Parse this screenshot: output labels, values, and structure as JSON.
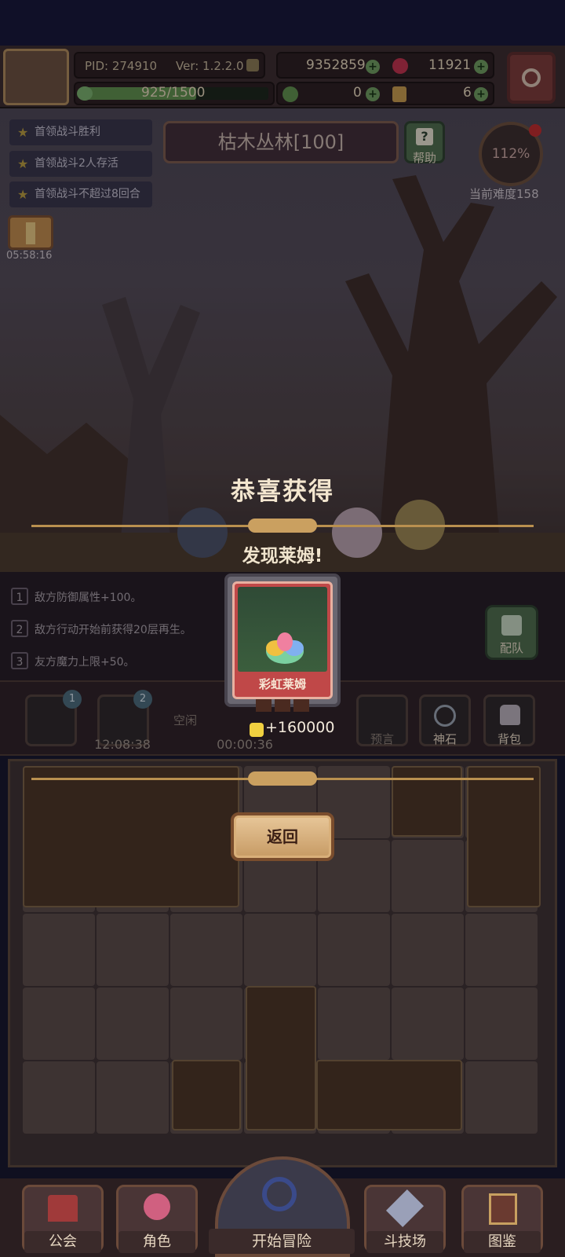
{
  "header": {
    "pid": "PID: 274910",
    "version": "Ver: 1.2.2.0",
    "exp_text": "925/1500",
    "exp_progress": 0.617,
    "gold": "9352859",
    "gems": "11921",
    "clover": "0",
    "keys": "6"
  },
  "quests": [
    {
      "label": "首领战斗胜利"
    },
    {
      "label": "首领战斗2人存活"
    },
    {
      "label": "首领战斗不超过8回合"
    }
  ],
  "timer": "05:58:16",
  "stage": {
    "title": "枯木丛林[100]",
    "help_label": "帮助"
  },
  "difficulty": {
    "percent": "112%",
    "label": "当前难度158"
  },
  "effects": [
    {
      "num": "1",
      "text": "敌方防御属性+100。"
    },
    {
      "num": "2",
      "text": "敌方行动开始前获得20层再生。"
    },
    {
      "num": "3",
      "text": "友方魔力上限+50。"
    }
  ],
  "team_button": "配队",
  "slots": [
    {
      "badge": "1",
      "time": ""
    },
    {
      "badge": "2",
      "time": "12:08:38"
    },
    {
      "label": "空闲",
      "time": "00:00:36"
    }
  ],
  "right_buttons": [
    {
      "label": "预言"
    },
    {
      "label": "神石"
    },
    {
      "label": "背包"
    }
  ],
  "reward_popup": {
    "title": "恭喜获得",
    "subtitle": "发现莱姆!",
    "card_name": "彩虹莱姆",
    "reward_amount": "+160000",
    "back_button": "返回"
  },
  "bottom_nav": {
    "guild": "公会",
    "character": "角色",
    "start": "开始冒险",
    "arena": "斗技场",
    "codex": "图鉴"
  },
  "colors": {
    "accent": "#b9904f",
    "plus": "#6e9b5c",
    "card": "#c04848"
  }
}
